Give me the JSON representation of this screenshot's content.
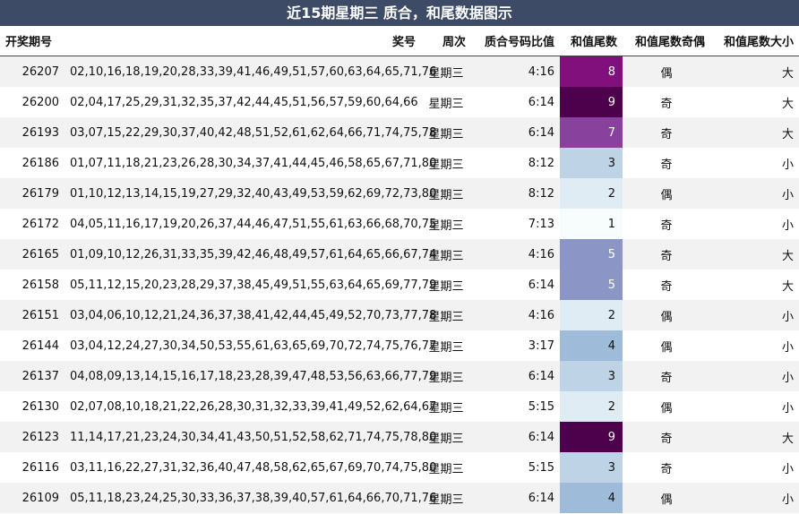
{
  "title": "近15期星期三 质合，和尾数据图示",
  "headers": [
    "开奖期号",
    "奖号",
    "周次",
    "质合号码比值",
    "和值尾数",
    "和值尾数奇偶",
    "和值尾数大小"
  ],
  "rows": [
    {
      "issue": "26207",
      "numbers": "02,10,16,18,19,20,28,33,39,41,46,49,51,57,60,63,64,65,71,76",
      "weekday": "星期三",
      "ratio": "4:16",
      "tail": "8",
      "parity": "偶",
      "size": "大"
    },
    {
      "issue": "26200",
      "numbers": "02,04,17,25,29,31,32,35,37,42,44,45,51,56,57,59,60,64,66",
      "weekday": "星期三",
      "ratio": "6:14",
      "tail": "9",
      "parity": "奇",
      "size": "大"
    },
    {
      "issue": "26193",
      "numbers": "03,07,15,22,29,30,37,40,42,48,51,52,61,62,64,66,71,74,75,78",
      "weekday": "星期三",
      "ratio": "6:14",
      "tail": "7",
      "parity": "奇",
      "size": "大"
    },
    {
      "issue": "26186",
      "numbers": "01,07,11,18,21,23,26,28,30,34,37,41,44,45,46,58,65,67,71,80",
      "weekday": "星期三",
      "ratio": "8:12",
      "tail": "3",
      "parity": "奇",
      "size": "小"
    },
    {
      "issue": "26179",
      "numbers": "01,10,12,13,14,15,19,27,29,32,40,43,49,53,59,62,69,72,73,80",
      "weekday": "星期三",
      "ratio": "8:12",
      "tail": "2",
      "parity": "偶",
      "size": "小"
    },
    {
      "issue": "26172",
      "numbers": "04,05,11,16,17,19,20,26,37,44,46,47,51,55,61,63,66,68,70,75",
      "weekday": "星期三",
      "ratio": "7:13",
      "tail": "1",
      "parity": "奇",
      "size": "小"
    },
    {
      "issue": "26165",
      "numbers": "01,09,10,12,26,31,33,35,39,42,46,48,49,57,61,64,65,66,67,74",
      "weekday": "星期三",
      "ratio": "4:16",
      "tail": "5",
      "parity": "奇",
      "size": "大"
    },
    {
      "issue": "26158",
      "numbers": "05,11,12,15,20,23,28,29,37,38,45,49,51,55,63,64,65,69,77,79",
      "weekday": "星期三",
      "ratio": "6:14",
      "tail": "5",
      "parity": "奇",
      "size": "大"
    },
    {
      "issue": "26151",
      "numbers": "03,04,06,10,12,21,24,36,37,38,41,42,44,45,49,52,70,73,77,78",
      "weekday": "星期三",
      "ratio": "4:16",
      "tail": "2",
      "parity": "偶",
      "size": "小"
    },
    {
      "issue": "26144",
      "numbers": "03,04,12,24,27,30,34,50,53,55,61,63,65,69,70,72,74,75,76,77",
      "weekday": "星期三",
      "ratio": "3:17",
      "tail": "4",
      "parity": "偶",
      "size": "小"
    },
    {
      "issue": "26137",
      "numbers": "04,08,09,13,14,15,16,17,18,23,28,39,47,48,53,56,63,66,77,79",
      "weekday": "星期三",
      "ratio": "6:14",
      "tail": "3",
      "parity": "奇",
      "size": "小"
    },
    {
      "issue": "26130",
      "numbers": "02,07,08,10,18,21,22,26,28,30,31,32,33,39,41,49,52,62,64,67",
      "weekday": "星期三",
      "ratio": "5:15",
      "tail": "2",
      "parity": "偶",
      "size": "小"
    },
    {
      "issue": "26123",
      "numbers": "11,14,17,21,23,24,30,34,41,43,50,51,52,58,62,71,74,75,78,80",
      "weekday": "星期三",
      "ratio": "6:14",
      "tail": "9",
      "parity": "奇",
      "size": "大"
    },
    {
      "issue": "26116",
      "numbers": "03,11,16,22,27,31,32,36,40,47,48,58,62,65,67,69,70,74,75,80",
      "weekday": "星期三",
      "ratio": "5:15",
      "tail": "3",
      "parity": "奇",
      "size": "小"
    },
    {
      "issue": "26109",
      "numbers": "05,11,18,23,24,25,30,33,36,37,38,39,40,57,61,64,66,70,71,76",
      "weekday": "星期三",
      "ratio": "6:14",
      "tail": "4",
      "parity": "偶",
      "size": "小"
    }
  ],
  "tail_colors": {
    "1": {
      "bg": "#f7fcfd",
      "fg": "#111111"
    },
    "2": {
      "bg": "#e0ecf4",
      "fg": "#111111"
    },
    "3": {
      "bg": "#bfd3e6",
      "fg": "#111111"
    },
    "4": {
      "bg": "#9ebcda",
      "fg": "#111111"
    },
    "5": {
      "bg": "#8c96c6",
      "fg": "#ffffff"
    },
    "7": {
      "bg": "#88419d",
      "fg": "#ffffff"
    },
    "8": {
      "bg": "#810f7c",
      "fg": "#ffffff"
    },
    "9": {
      "bg": "#4d004b",
      "fg": "#ffffff"
    }
  }
}
